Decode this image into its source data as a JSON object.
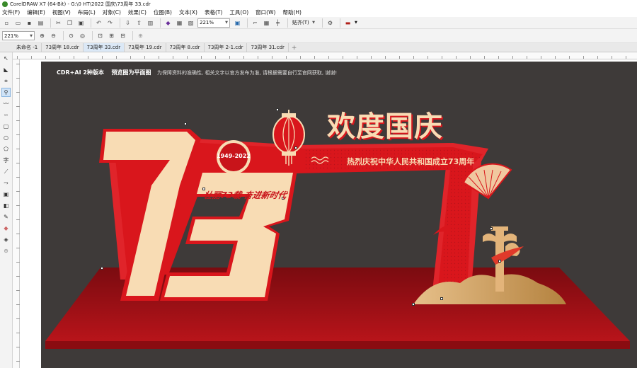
{
  "window": {
    "title": "CorelDRAW X7 (64-Bit) - G:\\0 HT\\2022 国庆\\73周年 33.cdr"
  },
  "menu": [
    "文件(F)",
    "编辑(E)",
    "视图(V)",
    "布局(L)",
    "对象(C)",
    "效果(C)",
    "位图(B)",
    "文本(X)",
    "表格(T)",
    "工具(O)",
    "窗口(W)",
    "帮助(H)"
  ],
  "toolbar": {
    "zoom_value": "221%",
    "snap_label": "贴齐(T)"
  },
  "propbar": {
    "zoom_value": "221%"
  },
  "tabs": [
    "未命名 -1",
    "73周年 18.cdr",
    "73周年 33.cdr",
    "73周年 19.cdr",
    "73周年 8.cdr",
    "73周年 2-1.cdr",
    "73周年 31.cdr"
  ],
  "active_tab": 2,
  "design": {
    "header_main": "CDR+AI 2种版本",
    "header_preview": "预览图为平面图",
    "header_note": "为保障资料的准确性, 相关文字以官方发布为准, 请根据需要自行至官网获取, 谢谢!",
    "big_digits": "73",
    "year_badge": "1949-2022",
    "title": "欢度国庆",
    "subtitle": "热烈庆祝中华人民共和国成立73周年",
    "slogan": "壮丽73载 奋进新时代"
  },
  "colors": {
    "artboard": "#3e3a39",
    "red": "#d9161c",
    "dark_red": "#8e0d12",
    "cream": "#f8dcb4",
    "gold": "#d7a96c"
  }
}
